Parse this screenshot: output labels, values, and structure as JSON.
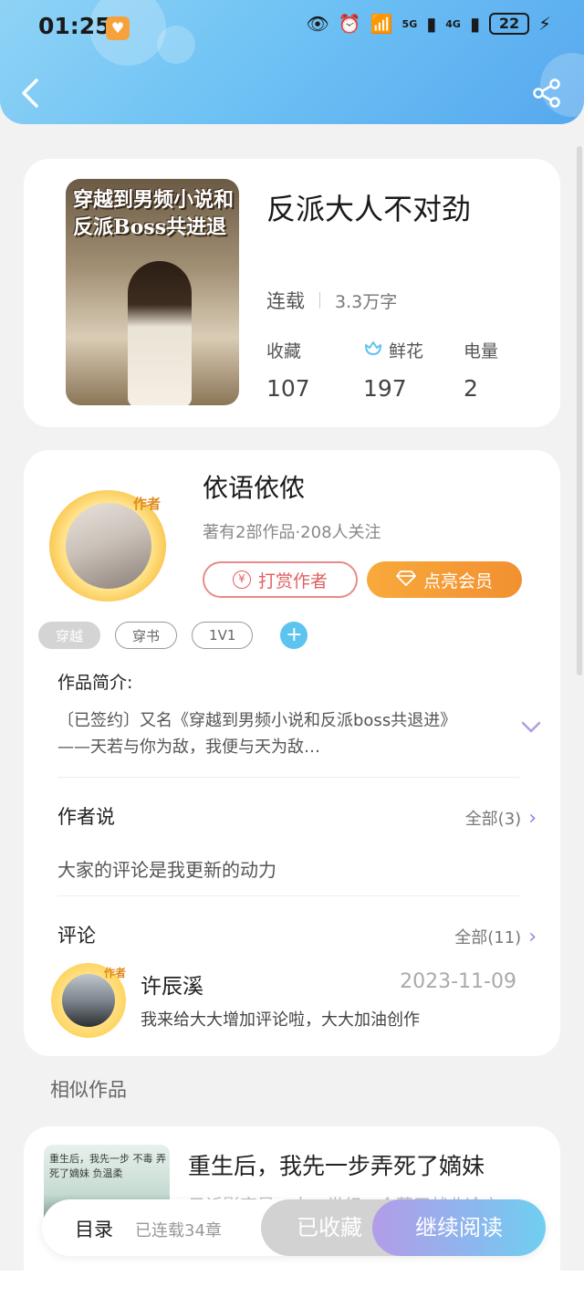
{
  "status_bar": {
    "time": "01:25",
    "network_5g": "5G",
    "network_4g": "4G",
    "battery": "22"
  },
  "book": {
    "cover_title": "穿越到男频小说和反派Boss共进退",
    "title": "反派大人不对劲",
    "status": "连载",
    "word_count": "3.3万字",
    "stats": [
      {
        "label": "收藏",
        "value": "107"
      },
      {
        "label": "鲜花",
        "value": "197",
        "icon": "flower-icon"
      },
      {
        "label": "电量",
        "value": "2"
      }
    ]
  },
  "author": {
    "badge": "作者",
    "name": "依语依侬",
    "info": "著有2部作品·208人关注",
    "reward_label": "打赏作者",
    "reward_icon": "¥",
    "vip_label": "点亮会员"
  },
  "tags": [
    "穿越",
    "穿书",
    "1V1"
  ],
  "tag_add": "+",
  "synopsis": {
    "title": "作品简介:",
    "line1": "〔已签约〕又名《穿越到男频小说和反派boss共退进》",
    "line2": "——天若与你为敌，我便与天为敌…"
  },
  "author_says": {
    "title": "作者说",
    "more": "全部(3)",
    "text": "大家的评论是我更新的动力"
  },
  "comments": {
    "title": "评论",
    "more": "全部(11)",
    "items": [
      {
        "badge": "作者",
        "user": "许辰溪",
        "date": "2023-11-09",
        "text": "我来给大大增加评论啦，大大加油创作"
      }
    ]
  },
  "similar": {
    "title": "相似作品",
    "cover_text": "重生后，我先一步 不毒 弄死了嫡妹 负温柔",
    "name": "重生后，我先一步弄死了嫡妹",
    "desc": "只䜣影变是二十一世纪一个莫王战北冷玄"
  },
  "bottom_bar": {
    "toc_label": "目录",
    "chapters": "已连载34章",
    "collected": "已收藏",
    "continue": "继续阅读"
  },
  "colors": {
    "header_gradient_start": "#8fd3f6",
    "header_gradient_end": "#56a8ee",
    "vip_orange": "#f29030",
    "reward_red": "#e06060",
    "accent_purple": "#9b7fe0"
  }
}
